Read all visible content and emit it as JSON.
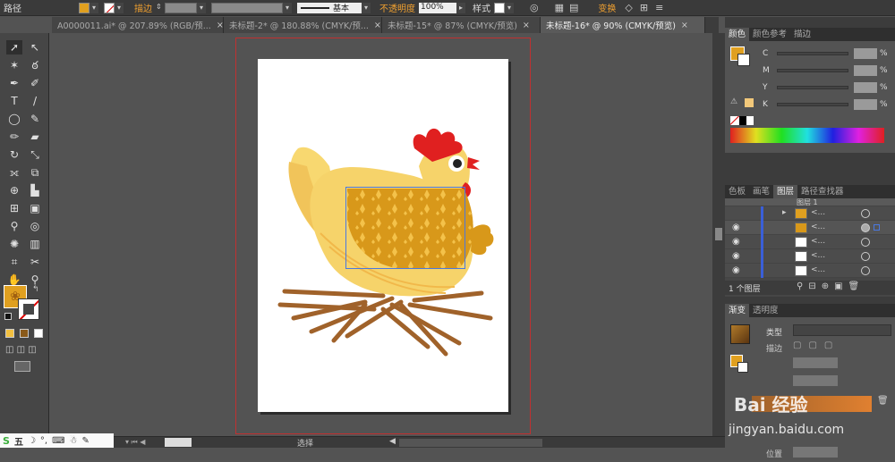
{
  "control_bar": {
    "path_label": "路径",
    "stroke_label": "描边",
    "stroke_style": "基本",
    "opacity_label": "不透明度",
    "opacity_value": "100%",
    "style_label": "样式",
    "transform_label": "变换"
  },
  "tabs": [
    {
      "label": "A0000011.ai* @ 207.89% (RGB/预...",
      "active": false
    },
    {
      "label": "未标题-2* @ 180.88% (CMYK/预...",
      "active": false
    },
    {
      "label": "未标题-15* @ 87% (CMYK/预览)",
      "active": false
    },
    {
      "label": "未标题-16* @ 90% (CMYK/预览)",
      "active": true
    }
  ],
  "color_panel": {
    "tabs": [
      "颜色",
      "颜色参考",
      "描边"
    ],
    "channels": [
      "C",
      "M",
      "Y",
      "K"
    ],
    "unit": "%"
  },
  "layers_panel": {
    "tabs": [
      "色板",
      "画笔",
      "图层",
      "路径查找器"
    ],
    "layer_name": "图层 1",
    "row_label": "<...",
    "footer": "1 个图层"
  },
  "gradient_panel": {
    "tabs": [
      "渐变",
      "透明度"
    ],
    "type_label": "类型",
    "stroke_label": "描边",
    "position_label": "位置"
  },
  "status": {
    "mode": "选择"
  },
  "ime_bar": {
    "mode": "五"
  },
  "watermark": {
    "text_big": "Bai 经验",
    "text_url": "jingyan.baidu.com"
  },
  "colors": {
    "fill": "#e0a020",
    "chicken_body": "#f6d36a",
    "comb": "#e02020",
    "twig": "#a0622a",
    "gradient": "#8a5a1a"
  }
}
